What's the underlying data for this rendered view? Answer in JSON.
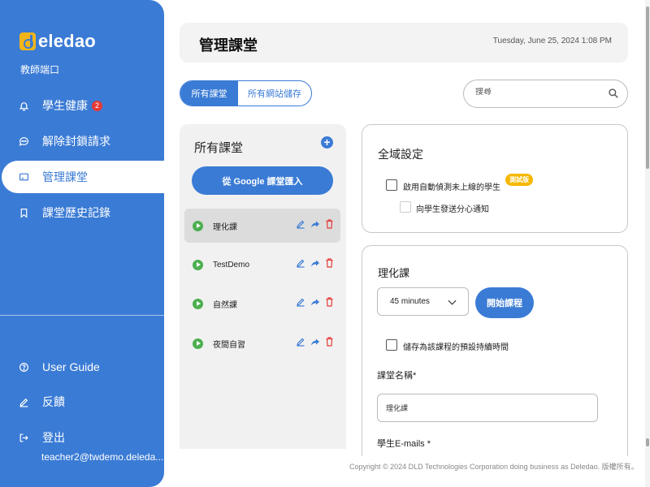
{
  "sidebar": {
    "logo_text": "eledao",
    "portal_label": "教師端口",
    "items": [
      {
        "label": "學生健康",
        "icon": "bell-icon",
        "badge": "2"
      },
      {
        "label": "解除封鎖請求",
        "icon": "chat-icon"
      },
      {
        "label": "管理課堂",
        "icon": "screen-icon",
        "active": true
      },
      {
        "label": "課堂歷史記錄",
        "icon": "bookmark-icon"
      }
    ],
    "bottom_items": [
      {
        "label": "User Guide",
        "icon": "help-circle-icon"
      },
      {
        "label": "反饋",
        "icon": "pencil-icon"
      },
      {
        "label": "登出",
        "icon": "logout-icon"
      }
    ],
    "user_email": "teacher2@twdemo.deleda..."
  },
  "header": {
    "title": "管理課堂",
    "date": "Tuesday, June 25, 2024 1:08 PM"
  },
  "tabs": [
    {
      "label": "所有課堂",
      "active": true
    },
    {
      "label": "所有網站儲存",
      "active": false
    }
  ],
  "search": {
    "placeholder": "搜尋"
  },
  "class_list": {
    "title": "所有課堂",
    "add_symbol": "+",
    "import_label": "從 Google 課堂匯入",
    "classes": [
      {
        "name": "理化課",
        "selected": true
      },
      {
        "name": "TestDemo"
      },
      {
        "name": "自然課"
      },
      {
        "name": "夜間自習"
      }
    ]
  },
  "global_settings": {
    "title": "全域設定",
    "auto_detect_label": "啟用自動偵測未上線的學生",
    "beta_badge": "測試版",
    "notify_label": "向學生發送分心通知"
  },
  "class_detail": {
    "title": "理化課",
    "duration_value": "45 minutes",
    "start_label": "開始課程",
    "save_default_label": "儲存為該課程的預設持續時間",
    "name_label": "課堂名稱*",
    "name_value": "理化課",
    "emails_label": "學生E-mails *"
  },
  "footer": "Copyright © 2024 DLD Technologies Corporation doing business as Deledao. 版權所有。",
  "colors": {
    "primary": "#3a7bd5",
    "play": "#4caf50",
    "delete": "#e53935",
    "beta": "#f5b800"
  }
}
